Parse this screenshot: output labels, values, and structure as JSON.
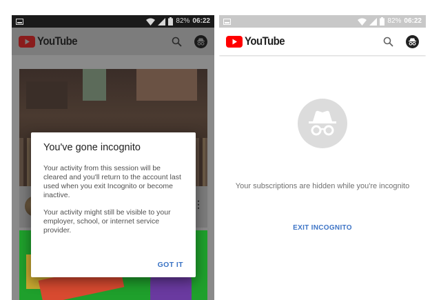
{
  "left_screen": {
    "status": {
      "battery": "82%",
      "time": "06:22"
    },
    "app": {
      "logo_text": "YouTube"
    },
    "dialog": {
      "title": "You've gone incognito",
      "paragraph1": "Your activity from this session will be cleared and you'll return to the account last used when you exit Incognito or become inactive.",
      "paragraph2": "Your activity might still be visible to your employer, school, or internet service provider.",
      "action": "GOT IT"
    }
  },
  "right_screen": {
    "status": {
      "battery": "82%",
      "time": "06:22"
    },
    "app": {
      "logo_text": "YouTube"
    },
    "message": "Your subscriptions are hidden while you're incognito",
    "exit_label": "EXIT INCOGNITO"
  },
  "icons": {
    "status_left": "image-icon",
    "signal": "wifi-icon",
    "cellular": "cellular-icon",
    "battery": "battery-icon",
    "search": "search-icon",
    "incognito": "incognito-icon",
    "more": "more-vertical-icon"
  },
  "colors": {
    "youtube_red": "#ff0000",
    "link_blue": "#3d74c6"
  }
}
